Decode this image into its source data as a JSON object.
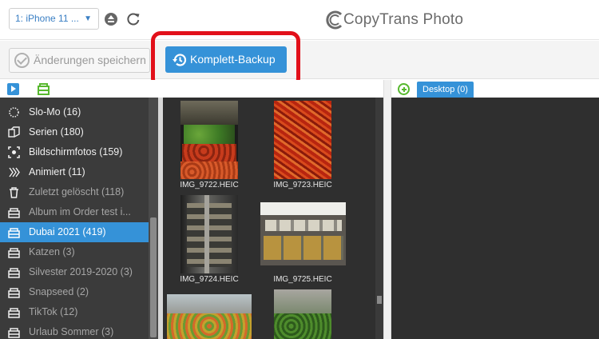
{
  "topbar": {
    "device_select": "1: iPhone 11 ...",
    "brand": "CopyTrans Photo"
  },
  "toolbar": {
    "save_label": "Änderungen speichern",
    "backup_label": "Komplett-Backup"
  },
  "panels": {
    "desktop_tab": "Desktop (0)"
  },
  "sidebar": {
    "items": [
      {
        "label": "Slo-Mo (16)",
        "icon": "slomo-icon"
      },
      {
        "label": "Serien (180)",
        "icon": "burst-icon"
      },
      {
        "label": "Bildschirmfotos (159)",
        "icon": "screenshot-icon"
      },
      {
        "label": "Animiert (11)",
        "icon": "animated-icon"
      },
      {
        "label": "Zuletzt gelöscht (118)",
        "icon": "trash-icon"
      },
      {
        "label": "Album im Order test i...",
        "icon": "album-icon"
      },
      {
        "label": "Dubai 2021 (419)",
        "icon": "album-icon"
      },
      {
        "label": "Katzen  (3)",
        "icon": "album-icon"
      },
      {
        "label": "Silvester 2019-2020 (3)",
        "icon": "album-icon"
      },
      {
        "label": "Snapseed (2)",
        "icon": "album-icon"
      },
      {
        "label": "TikTok (12)",
        "icon": "album-icon"
      },
      {
        "label": "Urlaub Sommer (3)",
        "icon": "album-icon"
      }
    ]
  },
  "photos": [
    {
      "name": "IMG_9722.HEIC"
    },
    {
      "name": "IMG_9723.HEIC"
    },
    {
      "name": "IMG_9724.HEIC"
    },
    {
      "name": "IMG_9725.HEIC"
    }
  ],
  "colors": {
    "accent": "#3592d8",
    "highlight": "#e2101a",
    "add_green": "#57b82e",
    "bulb": "#f5b400"
  }
}
